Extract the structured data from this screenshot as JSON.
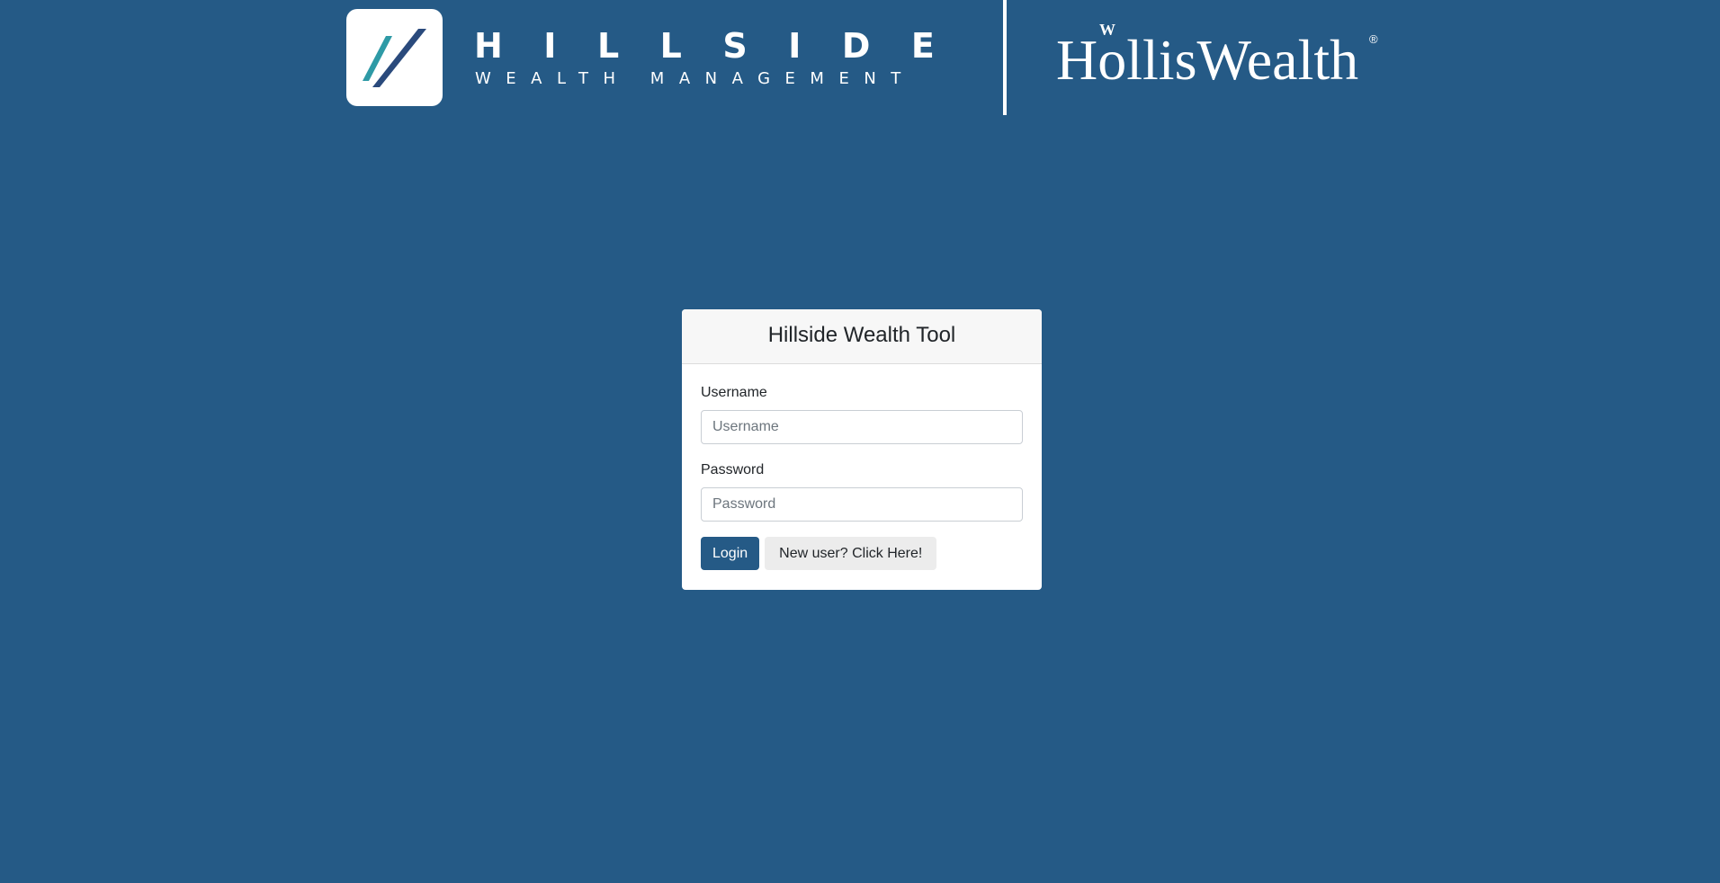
{
  "header": {
    "brand_name": "HILLSIDE",
    "brand_subtitle": "WEALTH MANAGEMENT",
    "logo_icon": "double-slash-logo-icon",
    "partner_name": "HollisWealth",
    "partner_mark": "®",
    "colors": {
      "logo_teal": "#2e9aa6",
      "logo_navy": "#2a4a7c"
    }
  },
  "login_card": {
    "title": "Hillside Wealth Tool",
    "username": {
      "label": "Username",
      "placeholder": "Username",
      "value": ""
    },
    "password": {
      "label": "Password",
      "placeholder": "Password",
      "value": ""
    },
    "login_button": "Login",
    "new_user_button": "New user? Click Here!"
  },
  "colors": {
    "background": "#255a86",
    "primary_button": "#255a86",
    "secondary_button": "#ececec",
    "card_header": "#f7f7f7"
  }
}
